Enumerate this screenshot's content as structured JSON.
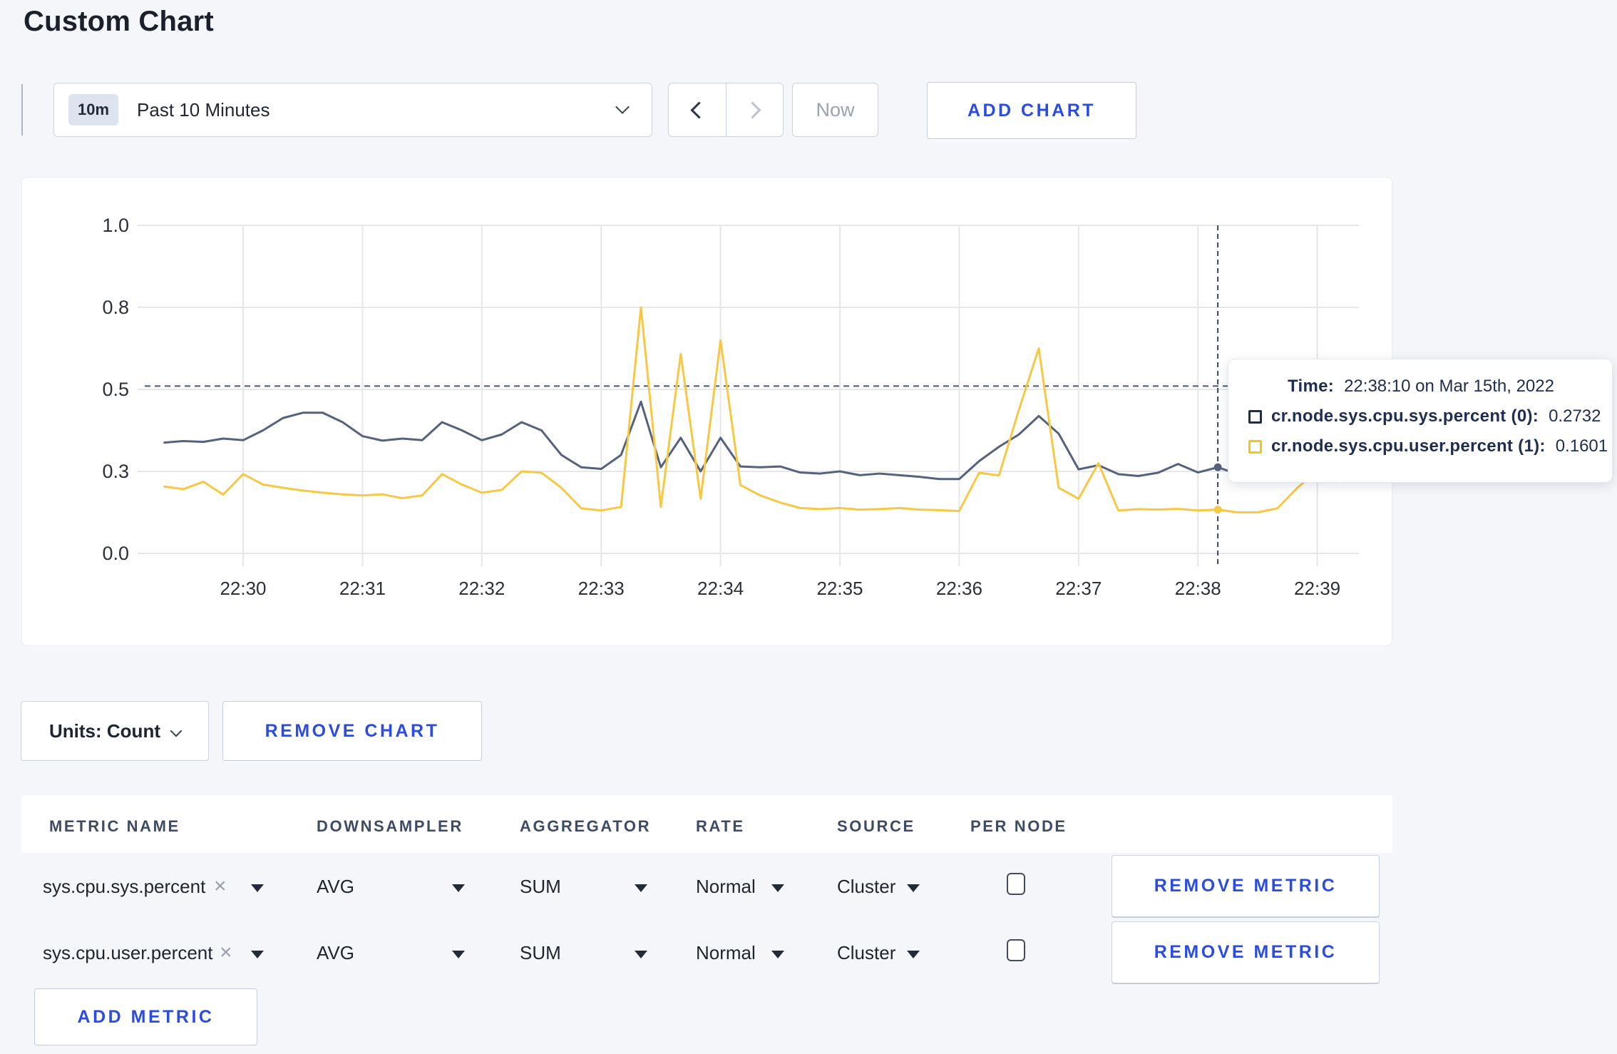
{
  "page": {
    "title": "Custom Chart"
  },
  "colors": {
    "accent_blue": "#2b4ce0",
    "series_sys": "#54627e",
    "series_user": "#f7c843",
    "guideline": "#44597a",
    "crosshair": "#3c4657",
    "grid": "#e7e7ea"
  },
  "toolbar": {
    "range_badge": "10m",
    "range_label": "Past 10 Minutes",
    "now_label": "Now",
    "add_chart_label": "ADD CHART"
  },
  "chart_data": {
    "type": "line",
    "title": "",
    "xlabel": "",
    "ylabel": "",
    "x_ticks": [
      "22:30",
      "22:31",
      "22:32",
      "22:33",
      "22:34",
      "22:35",
      "22:36",
      "22:37",
      "22:38",
      "22:39"
    ],
    "y_ticks": [
      0.0,
      0.3,
      0.5,
      0.8,
      1.0
    ],
    "ylim": [
      0.0,
      1.0
    ],
    "grid": true,
    "start_time": "22:29:20",
    "interval_seconds": 10,
    "guideline_y": 0.512,
    "crosshair_time": "22:38:10",
    "series": [
      {
        "name": "cr.node.sys.cpu.sys.percent",
        "color": "#54627e",
        "values": [
          0.37,
          0.374,
          0.372,
          0.38,
          0.376,
          0.4,
          0.43,
          0.443,
          0.443,
          0.42,
          0.386,
          0.375,
          0.38,
          0.376,
          0.42,
          0.4,
          0.376,
          0.39,
          0.42,
          0.4,
          0.34,
          0.31,
          0.306,
          0.34,
          0.47,
          0.31,
          0.382,
          0.3,
          0.382,
          0.312,
          0.31,
          0.312,
          0.296,
          0.292,
          0.3,
          0.286,
          0.292,
          0.286,
          0.28,
          0.272,
          0.272,
          0.325,
          0.36,
          0.39,
          0.435,
          0.392,
          0.305,
          0.315,
          0.29,
          0.283,
          0.295,
          0.318,
          0.296,
          0.31,
          0.29,
          0.3,
          0.31,
          0.297,
          0.3,
          0.305
        ]
      },
      {
        "name": "cr.node.sys.cpu.user.percent",
        "color": "#f7c843",
        "values": [
          0.245,
          0.235,
          0.262,
          0.215,
          0.29,
          0.252,
          0.24,
          0.23,
          0.222,
          0.216,
          0.212,
          0.216,
          0.202,
          0.212,
          0.29,
          0.252,
          0.222,
          0.232,
          0.3,
          0.295,
          0.24,
          0.165,
          0.157,
          0.17,
          0.8,
          0.17,
          0.63,
          0.2,
          0.68,
          0.25,
          0.212,
          0.186,
          0.166,
          0.162,
          0.166,
          0.16,
          0.162,
          0.166,
          0.16,
          0.158,
          0.155,
          0.295,
          0.285,
          0.45,
          0.65,
          0.24,
          0.2,
          0.32,
          0.157,
          0.162,
          0.16,
          0.163,
          0.157,
          0.16,
          0.15,
          0.15,
          0.165,
          0.24,
          0.3,
          0.26
        ]
      }
    ],
    "legend": "none"
  },
  "tooltip": {
    "time_label": "Time:",
    "time_value": "22:38:10 on Mar 15th, 2022",
    "series": [
      {
        "label": "cr.node.sys.cpu.sys.percent (0):",
        "value": "0.2732",
        "color": "#1f2d50"
      },
      {
        "label": "cr.node.sys.cpu.user.percent (1):",
        "value": "0.1601",
        "color": "#f5c518"
      }
    ]
  },
  "chart_controls": {
    "units_label": "Units: Count",
    "remove_chart_label": "REMOVE CHART"
  },
  "metrics_table": {
    "headers": [
      "METRIC NAME",
      "DOWNSAMPLER",
      "AGGREGATOR",
      "RATE",
      "SOURCE",
      "PER NODE"
    ],
    "rows": [
      {
        "metric": "sys.cpu.sys.percent",
        "close": "×",
        "downsampler": "AVG",
        "aggregator": "SUM",
        "rate": "Normal",
        "source": "Cluster",
        "per_node_checked": false,
        "remove_label": "REMOVE METRIC"
      },
      {
        "metric": "sys.cpu.user.percent",
        "close": "×",
        "downsampler": "AVG",
        "aggregator": "SUM",
        "rate": "Normal",
        "source": "Cluster",
        "per_node_checked": false,
        "remove_label": "REMOVE METRIC"
      }
    ],
    "add_metric_label": "ADD METRIC"
  }
}
